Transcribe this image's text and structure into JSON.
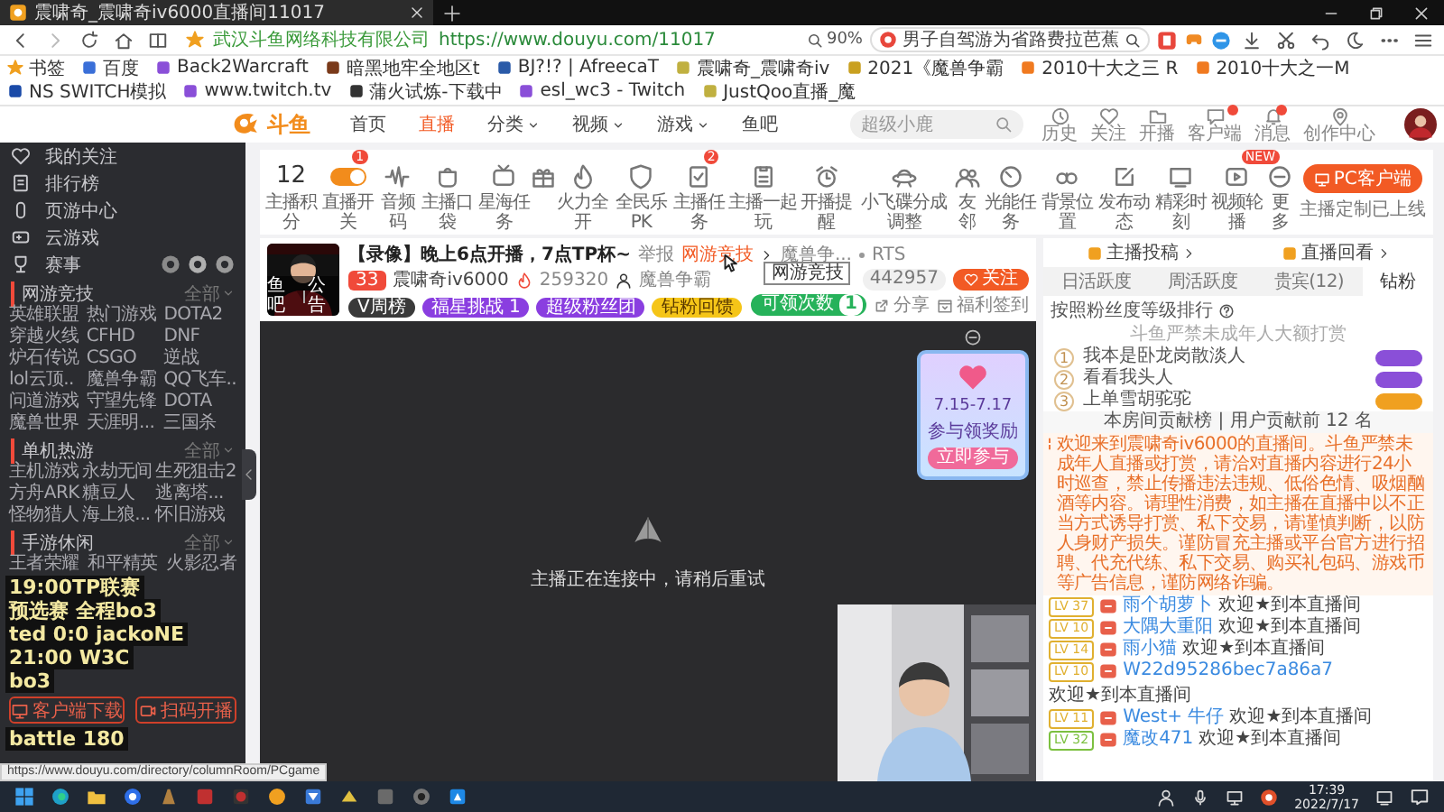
{
  "browser": {
    "tab_title": "震啸奇_震啸奇iv6000直播间11017",
    "site_owner": "武汉斗鱼网络科技有限公司",
    "url": "https://www.douyu.com/11017",
    "zoom": "90%",
    "search_value": "男子自驾游为省路费拉芭蕉"
  },
  "bookmarks": [
    "书签",
    "百度",
    "Back2Warcraft",
    "暗黑地牢全地区t",
    "BJ?!? | AfreecaT",
    "震啸奇_震啸奇iv",
    "2021《魔兽争霸",
    "2010十大之三 R",
    "2010十大之一M",
    "NS SWITCH模拟",
    "www.twitch.tv",
    "蒲火试炼-下载中",
    "esl_wc3 - Twitch",
    "JustQoo直播_魔"
  ],
  "site_header": {
    "logo": "斗鱼",
    "nav": [
      {
        "label": "首页",
        "selected": false,
        "dropdown": false
      },
      {
        "label": "直播",
        "selected": true,
        "dropdown": false
      },
      {
        "label": "分类",
        "selected": false,
        "dropdown": true
      },
      {
        "label": "视频",
        "selected": false,
        "dropdown": true
      },
      {
        "label": "游戏",
        "selected": false,
        "dropdown": true
      },
      {
        "label": "鱼吧",
        "selected": false,
        "dropdown": false
      }
    ],
    "search_placeholder": "超级小鹿",
    "user_links": [
      {
        "label": "历史",
        "badge": false
      },
      {
        "label": "关注",
        "badge": false
      },
      {
        "label": "开播",
        "badge": false
      },
      {
        "label": "客户端",
        "badge": true
      },
      {
        "label": "消息",
        "badge": true
      },
      {
        "label": "创作中心",
        "badge": false
      }
    ]
  },
  "sidebar": {
    "items": [
      {
        "label": "我的关注",
        "kind": "link"
      },
      {
        "label": "排行榜",
        "kind": "link"
      },
      {
        "label": "页游中心",
        "kind": "link"
      },
      {
        "label": "云游戏",
        "kind": "link"
      },
      {
        "label": "赛事",
        "kind": "events"
      }
    ],
    "sections": [
      {
        "title": "网游竞技",
        "more": "全部",
        "games": [
          "英雄联盟",
          "热门游戏",
          "DOTA2",
          "穿越火线",
          "CFHD",
          "DNF",
          "炉石传说",
          "CSGO",
          "逆战",
          "lol云顶..",
          "魔兽争霸",
          "QQ飞车..",
          "问道游戏",
          "守望先锋",
          "DOTA",
          "魔兽世界",
          "天涯明...",
          "三国杀"
        ]
      },
      {
        "title": "单机热游",
        "more": "全部",
        "games": [
          "主机游戏",
          "永劫无间",
          "生死狙击2",
          "方舟ARK",
          "糖豆人",
          "逃离塔...",
          "怪物猎人",
          "海上狼...",
          "怀旧游戏"
        ]
      },
      {
        "title": "手游休闲",
        "more": "全部",
        "games": [
          "王者荣耀",
          "和平精英",
          "火影忍者"
        ]
      }
    ],
    "buttons": [
      "客户端下载",
      "扫码开播"
    ]
  },
  "stream_overlay": {
    "upper": [
      "19:00TP联赛",
      "预选赛 全程bo3",
      "ted 0:0 jackoNE",
      "21:00 W3C",
      "bo3"
    ],
    "lower": [
      "battle 180"
    ]
  },
  "toolbar": {
    "score": "12",
    "score_label": "主播积分",
    "items": [
      {
        "kind": "toggle",
        "label": "直播开关",
        "badge": "1",
        "on": true
      },
      {
        "kind": "button",
        "label": "音频码"
      },
      {
        "kind": "button",
        "label": "主播口袋"
      },
      {
        "kind": "button",
        "label": "星海任务"
      },
      {
        "kind": "button"
      },
      {
        "kind": "button",
        "label": "火力全开"
      },
      {
        "kind": "button",
        "label": "全民乐PK"
      },
      {
        "kind": "button",
        "label": "主播任务",
        "badge": "2"
      },
      {
        "kind": "button",
        "label": "主播一起玩"
      },
      {
        "kind": "button",
        "label": "开播提醒"
      },
      {
        "kind": "button",
        "label": "小飞碟分成调整"
      },
      {
        "kind": "button",
        "label": "友邻"
      },
      {
        "kind": "button",
        "label": "光能任务"
      },
      {
        "kind": "button",
        "label": "背景位置"
      },
      {
        "kind": "button",
        "label": "发布动态"
      },
      {
        "kind": "button",
        "label": "精彩时刻"
      },
      {
        "kind": "button",
        "label": "视频轮播",
        "badge": "NEW"
      },
      {
        "kind": "button",
        "label": "更多"
      }
    ],
    "client_button": "PC客户端",
    "client_note": "主播定制已上线"
  },
  "room": {
    "title": "【录像】晚上6点开播，7点TP杯~",
    "report": "举报",
    "category": "网游竞技",
    "subcategory": "魔兽争...",
    "genre": "RTS",
    "tooltip": "网游竞技",
    "level": "33",
    "streamer": "震啸奇iv6000",
    "heat": "259320",
    "game": "魔兽争霸",
    "avatar_caption": [
      "鱼吧",
      "公告"
    ],
    "badges": [
      {
        "label": "V周榜",
        "color": "#3a3a3a"
      },
      {
        "label": "福星挑战 1",
        "color": "#8a3ee0"
      },
      {
        "label": "超级粉丝团",
        "color": "#8a3ee0"
      },
      {
        "label": "钻粉回馈",
        "color": "#f5c518"
      }
    ],
    "followers": "442957",
    "follow": "关注",
    "claim": "可领次数",
    "claim_count": "1",
    "share": "分享",
    "checkin": "福利签到"
  },
  "video": {
    "status": "主播正在连接中，请稍后重试"
  },
  "promo": {
    "dates": "7.15-7.17",
    "caption": "参与领奖励",
    "button": "立即参与"
  },
  "right_panel": {
    "links": [
      "主播投稿",
      "直播回看"
    ],
    "tabs": [
      {
        "label": "日活跃度",
        "selected": false
      },
      {
        "label": "周活跃度",
        "selected": false
      },
      {
        "label": "贵宾(12)",
        "selected": false
      },
      {
        "label": "钻粉",
        "selected": true
      }
    ],
    "rank_title": "按照粉丝度等级排行",
    "notice": "斗鱼严禁未成年人大额打赏",
    "ranks": [
      {
        "rank": "1",
        "name": "我本是卧龙岗散淡人",
        "color": "#8a4fd8"
      },
      {
        "rank": "2",
        "name": "看看我头人",
        "color": "#8a4fd8"
      },
      {
        "rank": "3",
        "name": "上单雪胡驼驼",
        "color": "#f0a020"
      }
    ],
    "contribution": "本房间贡献榜 | 用户贡献前 12 名",
    "system_message": "欢迎来到震啸奇iv6000的直播间。斗鱼严禁未成年人直播或打赏，请洽对直播内容进行24小时巡查，禁止传播违法违规、低俗色情、吸烟酗酒等内容。请理性消费，如主播在直播中以不正当方式诱导打赏、私下交易，请谨慎判断，以防人身财产损失。谨防冒充主播或平台官方进行招聘、代充代练、私下交易、购买礼包码、游戏币等广告信息，谨防网络诈骗。",
    "chat": [
      {
        "level": "LV 37",
        "color": "#e0b030",
        "name": "雨个胡萝卜",
        "text": "欢迎★到本直播间"
      },
      {
        "level": "LV 10",
        "color": "#e0b030",
        "name": "大隅大重阳",
        "text": "欢迎★到本直播间"
      },
      {
        "level": "LV 14",
        "color": "#e0b030",
        "name": "雨小猫",
        "text": "欢迎★到本直播间"
      },
      {
        "level": "LV 10",
        "color": "#e0b030",
        "name": "W22d95286bec7a86a7",
        "text": "欢迎★到本直播间"
      },
      {
        "level": "LV 11",
        "color": "#e0b030",
        "name": "West+ 牛仔",
        "text": "欢迎★到本直播间"
      },
      {
        "level": "LV 32",
        "color": "#7cc040",
        "name": "魔改471",
        "text": "欢迎★到本直播间"
      }
    ]
  },
  "status_url": "https://www.douyu.com/directory/columnRoom/PCgame",
  "taskbar": {
    "time": "17:39",
    "date": "2022/7/17"
  }
}
